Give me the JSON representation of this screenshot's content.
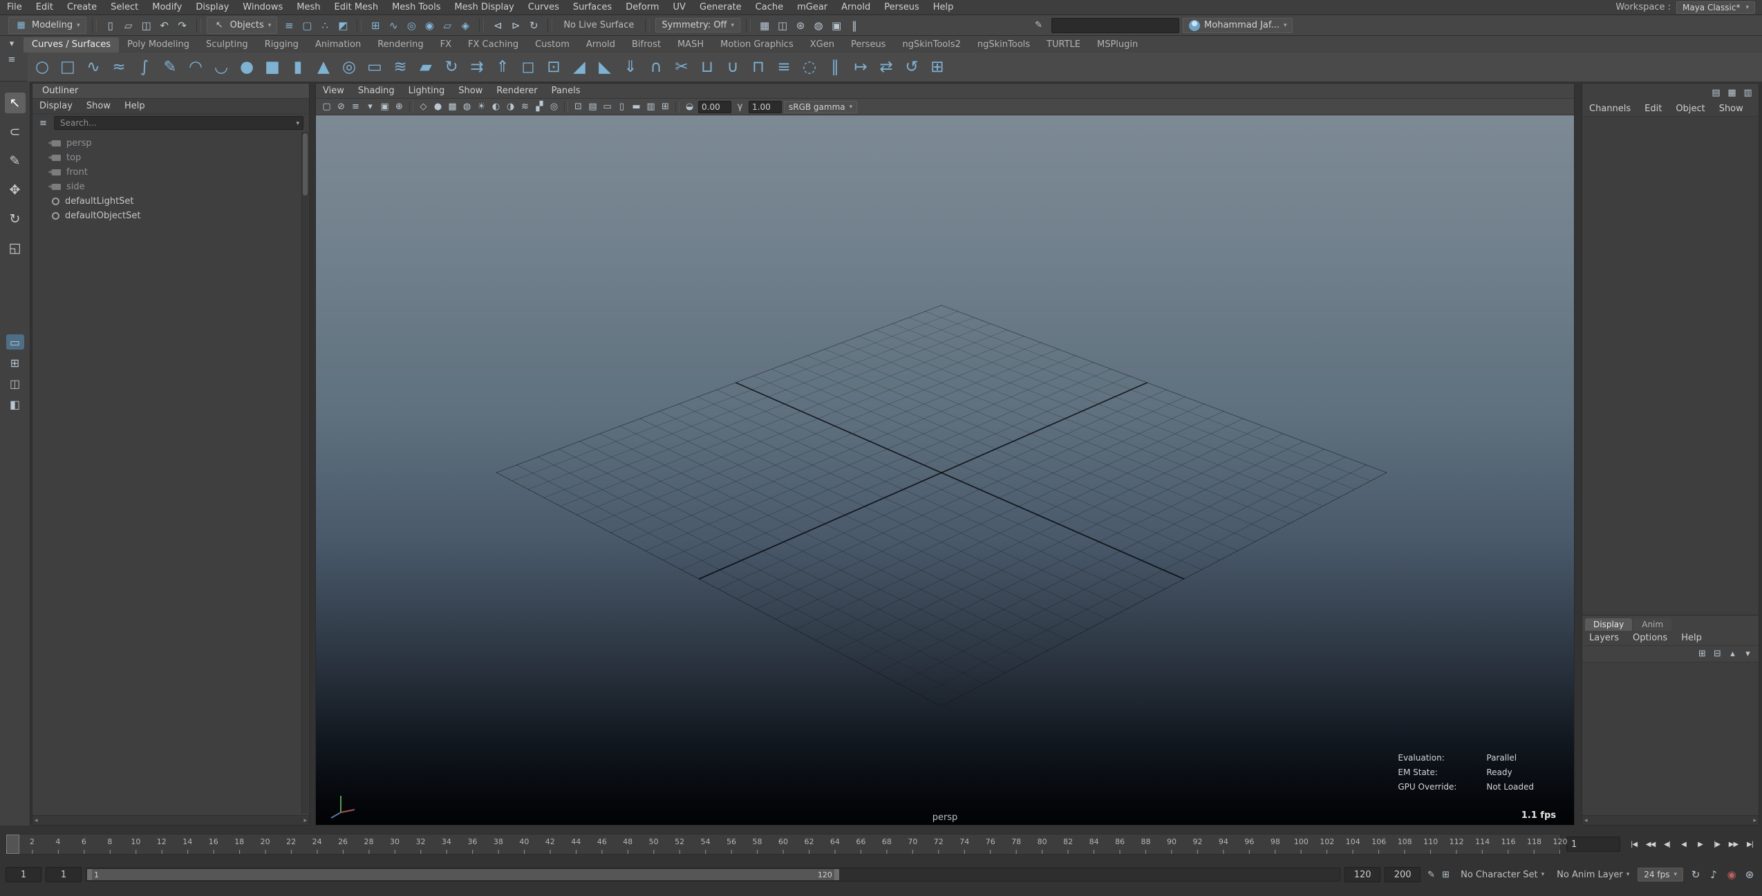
{
  "menubar": {
    "items": [
      "File",
      "Edit",
      "Create",
      "Select",
      "Modify",
      "Display",
      "Windows",
      "Mesh",
      "Edit Mesh",
      "Mesh Tools",
      "Mesh Display",
      "Curves",
      "Surfaces",
      "Deform",
      "UV",
      "Generate",
      "Cache",
      "mGear",
      "Arnold",
      "Perseus",
      "Help"
    ],
    "workspace_label": "Workspace :",
    "workspace_value": "Maya Classic*"
  },
  "statusline": {
    "menu_set": "Modeling",
    "menu_set_icon": "▦",
    "selection_label": "Objects",
    "selection_icon": "↖",
    "file_icons": [
      {
        "n": "new-scene-icon",
        "g": "▯"
      },
      {
        "n": "open-scene-icon",
        "g": "▱"
      },
      {
        "n": "save-scene-icon",
        "g": "◫"
      },
      {
        "n": "undo-icon",
        "g": "↶"
      },
      {
        "n": "redo-icon",
        "g": "↷"
      }
    ],
    "mask_icons": [
      {
        "n": "select-hierarchy-icon",
        "g": "≡"
      },
      {
        "n": "select-object-icon",
        "g": "▢"
      },
      {
        "n": "select-component-icon",
        "g": "∴"
      },
      {
        "n": "select-mask-icon",
        "g": "◩"
      }
    ],
    "snap_icons": [
      {
        "n": "snap-to-grid-icon",
        "g": "⊞"
      },
      {
        "n": "snap-to-curve-icon",
        "g": "∿"
      },
      {
        "n": "snap-to-point-icon",
        "g": "◎"
      },
      {
        "n": "snap-to-projected-center-icon",
        "g": "◉"
      },
      {
        "n": "snap-to-view-plane-icon",
        "g": "▱"
      },
      {
        "n": "make-live-icon",
        "g": "◈"
      }
    ],
    "history_icons": [
      {
        "n": "input-connections-icon",
        "g": "⊲"
      },
      {
        "n": "output-connections-icon",
        "g": "⊳"
      },
      {
        "n": "construction-history-icon",
        "g": "↻"
      }
    ],
    "live_surface_label": "No Live Surface",
    "symmetry_label": "Symmetry: Off",
    "render_icons": [
      {
        "n": "render-current-frame-icon",
        "g": "▦"
      },
      {
        "n": "ipr-render-icon",
        "g": "◫"
      },
      {
        "n": "render-settings-icon",
        "g": "⊛"
      },
      {
        "n": "hypershade-icon",
        "g": "◍"
      },
      {
        "n": "launch-render-view-icon",
        "g": "▣"
      },
      {
        "n": "pause-viewport-icon",
        "g": "‖"
      }
    ],
    "input_icon": "✎",
    "input_value": "",
    "account_label": "Mohammad Jaf..."
  },
  "shelf": {
    "menu_icons": [
      {
        "n": "shelf-tabs-menu-icon",
        "g": "▾"
      },
      {
        "n": "shelf-options-icon",
        "g": "≡"
      }
    ],
    "tabs": [
      "Curves / Surfaces",
      "Poly Modeling",
      "Sculpting",
      "Rigging",
      "Animation",
      "Rendering",
      "FX",
      "FX Caching",
      "Custom",
      "Arnold",
      "Bifrost",
      "MASH",
      "Motion Graphics",
      "XGen",
      "Perseus",
      "ngSkinTools2",
      "ngSkinTools",
      "TURTLE",
      "MSPlugin"
    ],
    "active_tab": "Curves / Surfaces",
    "icons": [
      {
        "n": "nurbs-circle",
        "g": "○"
      },
      {
        "n": "nurbs-square",
        "g": "□"
      },
      {
        "n": "cv-curve-tool",
        "g": "∿"
      },
      {
        "n": "ep-curve-tool",
        "g": "≈"
      },
      {
        "n": "bezier-curve-tool",
        "g": "∫"
      },
      {
        "n": "pencil-curve-tool",
        "g": "✎"
      },
      {
        "n": "three-point-arc",
        "g": "◠"
      },
      {
        "n": "two-point-arc",
        "g": "◡"
      },
      {
        "n": "nurbs-sphere",
        "g": "●"
      },
      {
        "n": "nurbs-cube",
        "g": "■"
      },
      {
        "n": "nurbs-cylinder",
        "g": "▮"
      },
      {
        "n": "nurbs-cone",
        "g": "▲"
      },
      {
        "n": "nurbs-torus",
        "g": "◎"
      },
      {
        "n": "nurbs-plane",
        "g": "▭"
      },
      {
        "n": "loft",
        "g": "≋"
      },
      {
        "n": "planar",
        "g": "▰"
      },
      {
        "n": "revolve",
        "g": "↻"
      },
      {
        "n": "birail",
        "g": "⇉"
      },
      {
        "n": "extrude",
        "g": "⇑"
      },
      {
        "n": "boundary",
        "g": "◻"
      },
      {
        "n": "square-surface",
        "g": "⊡"
      },
      {
        "n": "bevel",
        "g": "◢"
      },
      {
        "n": "bevel-plus",
        "g": "◣"
      },
      {
        "n": "project-curve-on-surface",
        "g": "⇓"
      },
      {
        "n": "intersect-surfaces",
        "g": "∩"
      },
      {
        "n": "trim-tool",
        "g": "✂"
      },
      {
        "n": "untrim-surfaces",
        "g": "⊔"
      },
      {
        "n": "attach-surfaces",
        "g": "∪"
      },
      {
        "n": "detach-surfaces",
        "g": "⊓"
      },
      {
        "n": "align-surfaces",
        "g": "≡"
      },
      {
        "n": "open-close-surfaces",
        "g": "◌"
      },
      {
        "n": "insert-isoparms",
        "g": "∥"
      },
      {
        "n": "extend-surfaces",
        "g": "↦"
      },
      {
        "n": "offset-surfaces",
        "g": "⇄"
      },
      {
        "n": "rebuild-surfaces",
        "g": "↺"
      },
      {
        "n": "nurbs-to-polygons",
        "g": "⊞"
      }
    ]
  },
  "toolbox": {
    "tools": [
      {
        "n": "select-tool",
        "g": "↖",
        "active": true
      },
      {
        "n": "lasso-select-tool",
        "g": "⊂"
      },
      {
        "n": "paint-select-tool",
        "g": "✎"
      },
      {
        "n": "move-tool",
        "g": "✥"
      },
      {
        "n": "rotate-tool",
        "g": "↻"
      },
      {
        "n": "scale-tool",
        "g": "◱"
      }
    ],
    "layouts": [
      {
        "n": "layout-single-pane",
        "g": "▭",
        "active": true
      },
      {
        "n": "layout-four-pane",
        "g": "⊞"
      },
      {
        "n": "layout-persp-outliner",
        "g": "◫"
      },
      {
        "n": "layout-hypergraph-persp",
        "g": "◧"
      }
    ]
  },
  "outliner": {
    "title": "Outliner",
    "menus": [
      "Display",
      "Show",
      "Help"
    ],
    "search_placeholder": "Search...",
    "items": [
      {
        "label": "persp",
        "icon": "camera",
        "muted": true
      },
      {
        "label": "top",
        "icon": "camera",
        "muted": true
      },
      {
        "label": "front",
        "icon": "camera",
        "muted": true
      },
      {
        "label": "side",
        "icon": "camera",
        "muted": true
      },
      {
        "label": "defaultLightSet",
        "icon": "set",
        "muted": false
      },
      {
        "label": "defaultObjectSet",
        "icon": "set",
        "muted": false
      }
    ]
  },
  "viewport": {
    "menus": [
      "View",
      "Shading",
      "Lighting",
      "Show",
      "Renderer",
      "Panels"
    ],
    "toolbar_icons_a": [
      {
        "n": "select-camera-icon",
        "g": "▢"
      },
      {
        "n": "lock-camera-icon",
        "g": "⊘"
      },
      {
        "n": "camera-attributes-icon",
        "g": "≡"
      },
      {
        "n": "bookmarks-icon",
        "g": "▾"
      },
      {
        "n": "image-plane-icon",
        "g": "▣"
      },
      {
        "n": "2d-pan-zoom-icon",
        "g": "⊕"
      }
    ],
    "toolbar_icons_b": [
      {
        "n": "wireframe-icon",
        "g": "◇"
      },
      {
        "n": "smooth-shade-icon",
        "g": "●"
      },
      {
        "n": "textured-icon",
        "g": "▩"
      },
      {
        "n": "use-default-material-icon",
        "g": "◍"
      },
      {
        "n": "lights-icon",
        "g": "☀"
      },
      {
        "n": "shadows-icon",
        "g": "◐"
      },
      {
        "n": "screen-space-ao-icon",
        "g": "◑"
      },
      {
        "n": "motion-blur-icon",
        "g": "≋"
      },
      {
        "n": "anti-aliasing-icon",
        "g": "▞"
      },
      {
        "n": "depth-of-field-icon",
        "g": "◎"
      }
    ],
    "toolbar_icons_c": [
      {
        "n": "isolate-select-icon",
        "g": "⊡"
      },
      {
        "n": "field-chart-icon",
        "g": "▤"
      },
      {
        "n": "resolution-gate-icon",
        "g": "▭"
      },
      {
        "n": "gate-mask-icon",
        "g": "▯"
      },
      {
        "n": "film-gate-icon",
        "g": "▬"
      },
      {
        "n": "hud-toggle-icon",
        "g": "▥"
      },
      {
        "n": "grid-toggle-icon",
        "g": "⊞"
      }
    ],
    "exposure_icon": "◒",
    "exposure_value": "0.00",
    "gamma_icon": "γ",
    "gamma_value": "1.00",
    "view_transform": "sRGB gamma",
    "camera_label": "persp",
    "hud": [
      {
        "label": "Evaluation:",
        "value": "Parallel"
      },
      {
        "label": "EM State:",
        "value": "Ready"
      },
      {
        "label": "GPU Override:",
        "value": "Not Loaded"
      }
    ],
    "fps": "1.1 fps"
  },
  "channelbox": {
    "menus": [
      "Channels",
      "Edit",
      "Object",
      "Show"
    ],
    "panel_toggles": [
      {
        "n": "channel-box-toggle-icon",
        "g": "▤"
      },
      {
        "n": "layer-editor-toggle-icon",
        "g": "▦"
      },
      {
        "n": "attribute-editor-toggle-icon",
        "g": "▥"
      }
    ]
  },
  "layer_editor": {
    "tabs": [
      {
        "label": "Display",
        "active": true
      },
      {
        "label": "Anim",
        "active": false
      }
    ],
    "menus": [
      "Layers",
      "Options",
      "Help"
    ],
    "icons": [
      {
        "n": "new-empty-layer-icon",
        "g": "⊞"
      },
      {
        "n": "new-layer-from-selected-icon",
        "g": "⊟"
      },
      {
        "n": "move-layer-up-icon",
        "g": "▴"
      },
      {
        "n": "move-layer-down-icon",
        "g": "▾"
      }
    ]
  },
  "timeline": {
    "start": 1,
    "end": 120,
    "label_step": 2,
    "current_frame": 1
  },
  "transport": [
    {
      "n": "go-to-start-button",
      "g": "|◀"
    },
    {
      "n": "step-back-key-button",
      "g": "◀◀"
    },
    {
      "n": "step-back-frame-button",
      "g": "◀|"
    },
    {
      "n": "play-backwards-button",
      "g": "◀"
    },
    {
      "n": "play-forwards-button",
      "g": "▶"
    },
    {
      "n": "step-forward-frame-button",
      "g": "|▶"
    },
    {
      "n": "step-forward-key-button",
      "g": "▶▶"
    },
    {
      "n": "go-to-end-button",
      "g": "▶|"
    }
  ],
  "range": {
    "anim_start": "1",
    "play_start": "1",
    "play_end": "120",
    "anim_end": "200",
    "bar_start_label": "1",
    "bar_end_label": "120"
  },
  "playback": {
    "character_set": "No Character Set",
    "anim_layer": "No Anim Layer",
    "fps": "24 fps",
    "pre_icons": [
      {
        "n": "edit-playback-range-icon",
        "g": "✎"
      },
      {
        "n": "playback-options-icon",
        "g": "⊞"
      }
    ],
    "post_icons": [
      {
        "n": "loop-icon",
        "g": "↻"
      },
      {
        "n": "mute-icon",
        "g": "♪"
      },
      {
        "n": "auto-keyframe-icon",
        "g": "◉",
        "c": "#bd6060"
      },
      {
        "n": "animation-preferences-icon",
        "g": "⊛"
      }
    ]
  }
}
